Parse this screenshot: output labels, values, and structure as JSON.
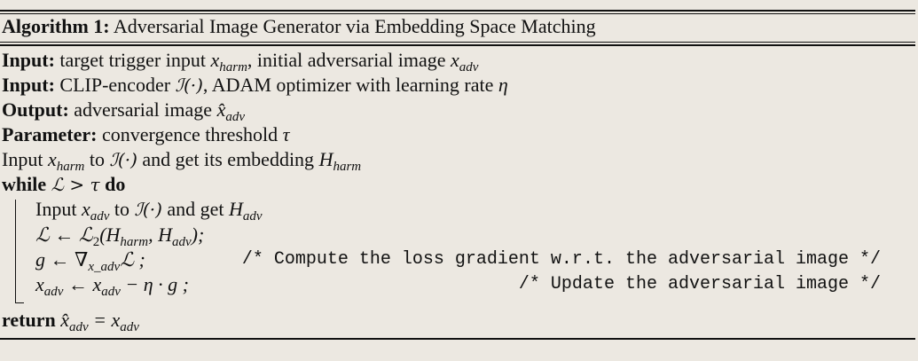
{
  "algorithm": {
    "label": "Algorithm 1:",
    "title": "Adversarial Image Generator via Embedding Space Matching"
  },
  "header": {
    "input1": {
      "kw": "Input:",
      "t1": "target trigger input",
      "x": "x",
      "harm": "harm",
      "t2": ", initial adversarial image",
      "x2": "x",
      "adv": "adv"
    },
    "input2": {
      "kw": "Input:",
      "t1": "CLIP-encoder",
      "enc": "ℐ(·)",
      "t2": ", ADAM optimizer with learning rate",
      "eta": "η"
    },
    "output": {
      "kw": "Output:",
      "t1": "adversarial image",
      "xhat": "x̂",
      "adv": "adv"
    },
    "param": {
      "kw": "Parameter:",
      "t1": "convergence threshold",
      "tau": "τ"
    }
  },
  "body": {
    "line1": {
      "t1": "Input",
      "x": "x",
      "harm": "harm",
      "t2": "to",
      "enc": "ℐ(·)",
      "t3": "and get its embedding",
      "H": "H",
      "harm2": "harm"
    },
    "while": {
      "kw": "while",
      "cond": "ℒ > τ",
      "do": "do"
    },
    "w1": {
      "t1": "Input",
      "x": "x",
      "adv": "adv",
      "t2": "to",
      "enc": "ℐ(·)",
      "t3": "and get",
      "H": "H",
      "adv2": "adv"
    },
    "w2": {
      "expr1": "ℒ ← ℒ",
      "two": "2",
      "expr2": "(H",
      "harm": "harm",
      "expr3": ", H",
      "adv": "adv",
      "expr4": ");"
    },
    "w3": {
      "expr1": "g ← ∇",
      "sub": "x_adv",
      "expr2": "ℒ ;",
      "comment": "/* Compute the loss gradient w.r.t. the adversarial image */"
    },
    "w4": {
      "x": "x",
      "adv": "adv",
      "expr1": "← x",
      "adv2": "adv",
      "expr2": "− η · g ;",
      "comment": "/* Update the adversarial image */"
    },
    "ret": {
      "kw": "return",
      "xhat": "x̂",
      "adv": "adv",
      "eq": "= x",
      "adv2": "adv"
    }
  }
}
